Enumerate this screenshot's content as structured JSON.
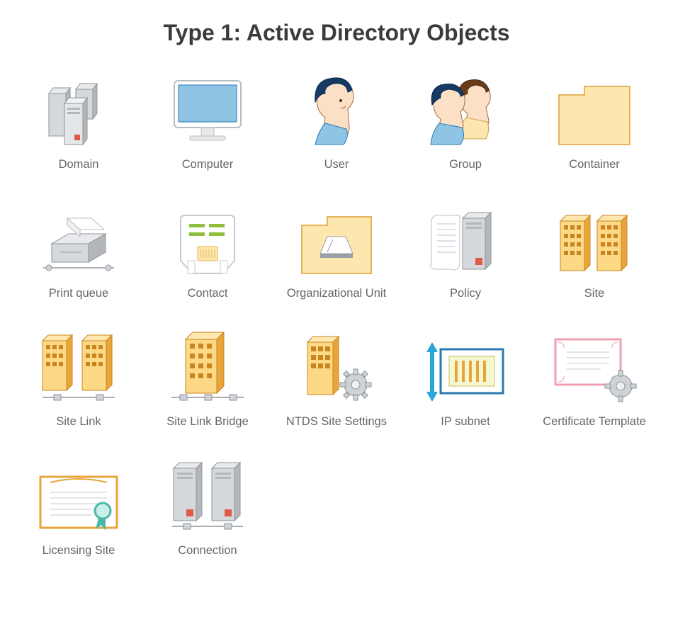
{
  "title": "Type 1: Active Directory Objects",
  "items": [
    {
      "icon": "domain-icon",
      "label": "Domain"
    },
    {
      "icon": "computer-icon",
      "label": "Computer"
    },
    {
      "icon": "user-icon",
      "label": "User"
    },
    {
      "icon": "group-icon",
      "label": "Group"
    },
    {
      "icon": "container-icon",
      "label": "Container"
    },
    {
      "icon": "print-queue-icon",
      "label": "Print queue"
    },
    {
      "icon": "contact-icon",
      "label": "Contact"
    },
    {
      "icon": "org-unit-icon",
      "label": "Organizational Unit"
    },
    {
      "icon": "policy-icon",
      "label": "Policy"
    },
    {
      "icon": "site-icon",
      "label": "Site"
    },
    {
      "icon": "site-link-icon",
      "label": "Site Link"
    },
    {
      "icon": "site-link-bridge-icon",
      "label": "Site Link Bridge"
    },
    {
      "icon": "ntds-icon",
      "label": "NTDS Site Settings"
    },
    {
      "icon": "ip-subnet-icon",
      "label": "IP subnet"
    },
    {
      "icon": "cert-template-icon",
      "label": "Certificate Template"
    },
    {
      "icon": "licensing-site-icon",
      "label": "Licensing Site"
    },
    {
      "icon": "connection-icon",
      "label": "Connection"
    }
  ],
  "colors": {
    "gold_light": "#fdd985",
    "gold_dark": "#e8a63a",
    "gold_stroke": "#c98520",
    "cream": "#fde7af",
    "cream_stroke": "#e6b55a",
    "steel_light": "#d6d9db",
    "steel_dark": "#b4b7ba",
    "steel_stroke": "#8f9398",
    "blue_screen": "#8fc4e4",
    "blue_stroke": "#2a7ab0",
    "paper": "#ffffff",
    "paper_edge": "#c7cbd0",
    "pink": "#ef9fb0",
    "green": "#8fbf3f"
  }
}
